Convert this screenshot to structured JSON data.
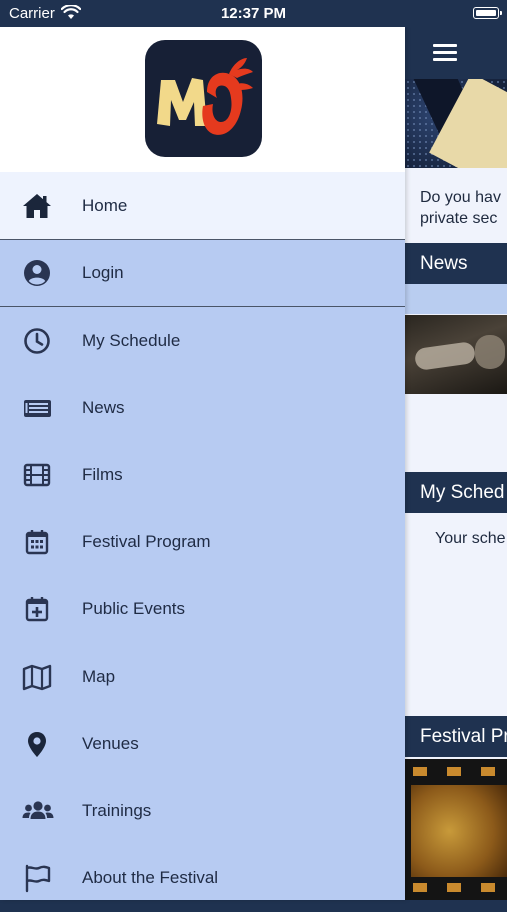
{
  "status_bar": {
    "carrier": "Carrier",
    "time": "12:37 PM"
  },
  "colors": {
    "nav_dark": "#1f3250",
    "drawer_bg": "#b7cbf2",
    "active_bg": "#eef3fe",
    "logo_bg": "#172036",
    "logo_red": "#e53a1e",
    "logo_yellow": "#f2d98a"
  },
  "drawer": {
    "logo_text": "MO",
    "items": [
      {
        "label": "Home",
        "icon": "home-icon"
      },
      {
        "label": "Login",
        "icon": "user-circle-icon"
      },
      {
        "label": "My Schedule",
        "icon": "clock-icon"
      },
      {
        "label": "News",
        "icon": "newspaper-icon"
      },
      {
        "label": "Films",
        "icon": "film-icon"
      },
      {
        "label": "Festival Program",
        "icon": "calendar-icon"
      },
      {
        "label": "Public Events",
        "icon": "calendar-plus-icon"
      },
      {
        "label": "Map",
        "icon": "map-icon"
      },
      {
        "label": "Venues",
        "icon": "map-pin-icon"
      },
      {
        "label": "Trainings",
        "icon": "users-icon"
      },
      {
        "label": "About the Festival",
        "icon": "flag-icon"
      }
    ]
  },
  "content": {
    "question_line1": "Do you hav",
    "question_line2": "private sec",
    "news_header": "News",
    "schedule_header": "My Sched",
    "schedule_text": "Your sche",
    "festival_header": "Festival Pr"
  }
}
